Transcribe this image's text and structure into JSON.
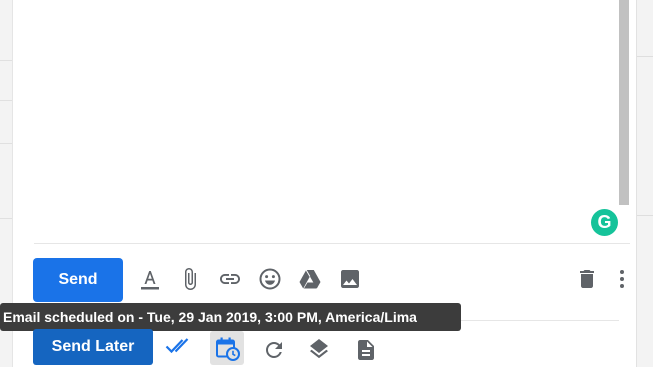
{
  "compose": {
    "grammarly_letter": "G",
    "send_label": "Send",
    "formatting_icons": [
      "text-format-icon",
      "attach-icon",
      "link-icon",
      "emoji-icon",
      "drive-icon",
      "photo-icon"
    ],
    "right_icons": [
      "trash-icon",
      "more-vert-icon"
    ]
  },
  "tooltip": {
    "text": "Email scheduled on - Tue, 29 Jan 2019, 3:00 PM,  America/Lima"
  },
  "scheduler_bar": {
    "send_later_label": "Send Later",
    "icons": [
      "double-check-icon",
      "calendar-clock-icon",
      "refresh-icon",
      "layers-icon",
      "document-icon"
    ]
  },
  "colors": {
    "primary": "#1a73e8",
    "send_later": "#1565c0",
    "icon_gray": "#5f6368",
    "grammarly": "#15c39a",
    "tooltip_bg": "#3c3c3c"
  }
}
